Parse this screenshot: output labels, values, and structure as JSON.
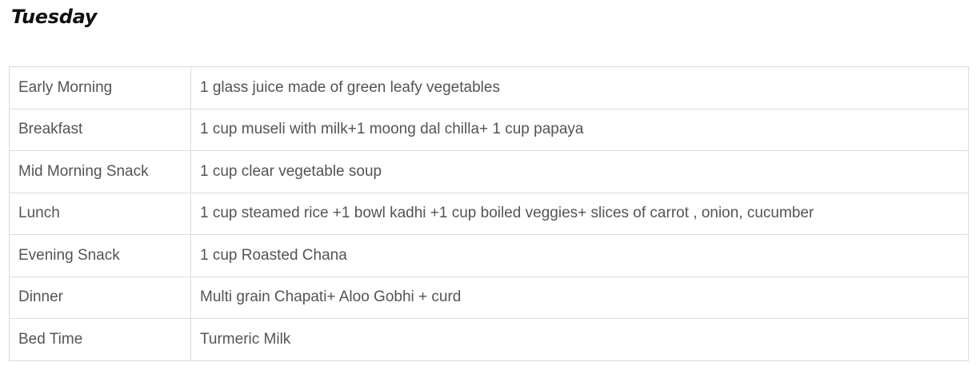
{
  "page": {
    "title": "Tuesday"
  },
  "meal_plan": {
    "rows": [
      {
        "meal": "Early Morning",
        "items": "1 glass juice made of green leafy vegetables"
      },
      {
        "meal": "Breakfast",
        "items": "1 cup museli with milk+1 moong dal chilla+ 1 cup papaya"
      },
      {
        "meal": "Mid Morning Snack",
        "items": "1 cup clear vegetable soup"
      },
      {
        "meal": "Lunch",
        "items": "1 cup steamed rice +1 bowl kadhi +1 cup boiled veggies+ slices of carrot , onion, cucumber"
      },
      {
        "meal": "Evening Snack",
        "items": "1 cup Roasted Chana"
      },
      {
        "meal": "Dinner",
        "items": "Multi grain Chapati+ Aloo Gobhi + curd"
      },
      {
        "meal": "Bed Time",
        "items": "Turmeric Milk"
      }
    ]
  }
}
